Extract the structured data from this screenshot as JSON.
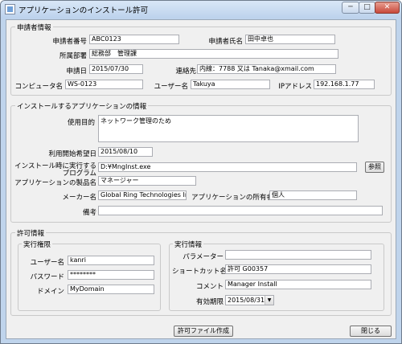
{
  "window": {
    "title": "アプリケーションのインストール許可",
    "minimize": "─",
    "maximize": "□",
    "close": "✕"
  },
  "applicant": {
    "legend": "申請者情報",
    "number_label": "申請者番号",
    "number": "ABC0123",
    "name_label": "申請者氏名",
    "name": "田中卓也",
    "dept_label": "所属部署",
    "dept": "総務部　管理課",
    "date_label": "申請日",
    "date": "2015/07/30",
    "contact_label": "連絡先",
    "contact": "内線：7788 又は Tanaka@xmail.com",
    "computer_label": "コンピュータ名",
    "computer": "WS-0123",
    "user_label": "ユーザー名",
    "user": "Takuya",
    "ip_label": "IPアドレス",
    "ip": "192.168.1.77"
  },
  "app_info": {
    "legend": "インストールするアプリケーションの情報",
    "purpose_label": "使用目的",
    "purpose": "ネットワーク管理のため",
    "start_label": "利用開始希望日",
    "start": "2015/08/10",
    "exec_label_1": "インストール時に実行する",
    "exec_label_2": "プログラム",
    "exec": "D:¥MngInst.exe",
    "browse": "参照",
    "product_label": "アプリケーションの製品名",
    "product": "マネージャー",
    "maker_label": "メーカー名",
    "maker": "Global Ring Technologies Inc.",
    "owner_label": "アプリケーションの所有者",
    "owner": "個人",
    "note_label": "備考",
    "note": ""
  },
  "permission": {
    "legend": "許可情報",
    "exec_auth_legend": "実行権限",
    "user_label": "ユーザー名",
    "user": "kanri",
    "password_label": "パスワード",
    "password": "********",
    "domain_label": "ドメイン",
    "domain": "MyDomain",
    "exec_info_legend": "実行情報",
    "param_label": "パラメーター",
    "param": "",
    "shortcut_label": "ショートカット名",
    "shortcut": "許可 G00357",
    "comment_label": "コメント",
    "comment": "Manager Install",
    "expiry_label": "有効期限",
    "expiry": "2015/08/31"
  },
  "footer": {
    "create": "許可ファイル作成",
    "close": "閉じる"
  },
  "icons": {
    "dropdown": "▼"
  }
}
